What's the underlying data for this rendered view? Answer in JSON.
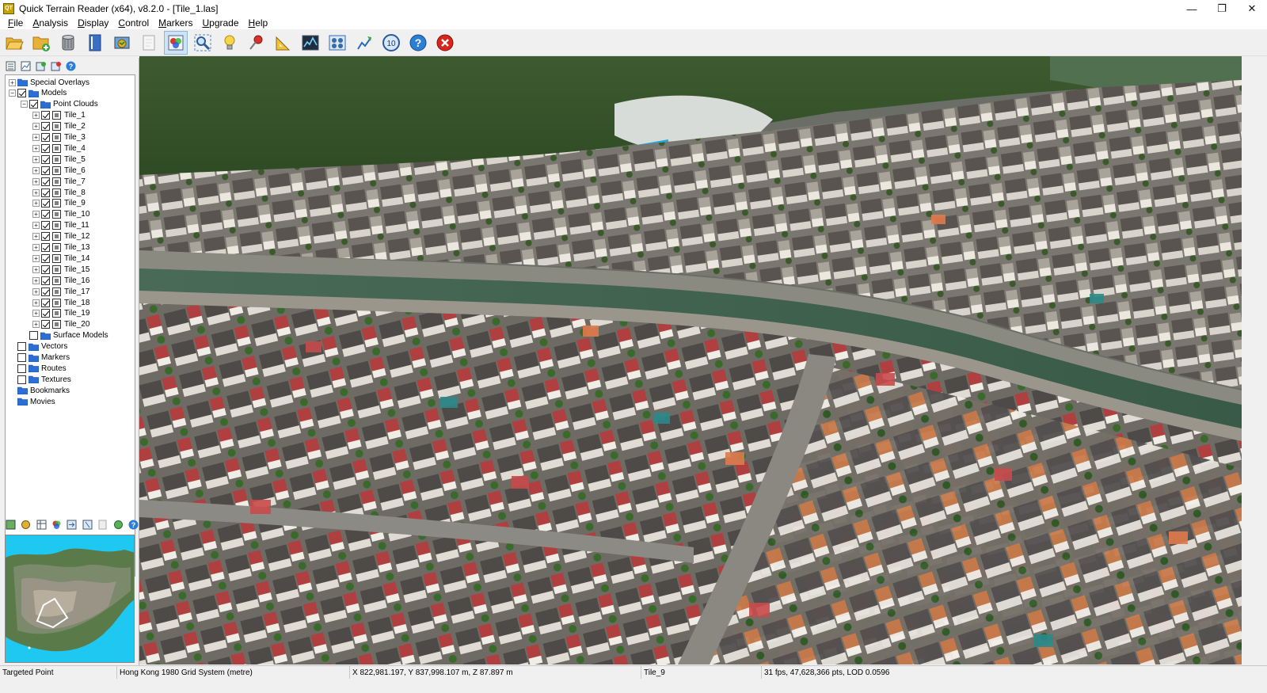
{
  "window": {
    "title": "Quick Terrain Reader (x64), v8.2.0 - [Tile_1.las]",
    "app_icon_text": "QT",
    "controls": [
      "minimize-icon",
      "restore-icon",
      "close-icon"
    ]
  },
  "menu": [
    "File",
    "Analysis",
    "Display",
    "Control",
    "Markers",
    "Upgrade",
    "Help"
  ],
  "toolbar": {
    "buttons": [
      {
        "name": "open-folder-icon"
      },
      {
        "name": "add-folder-icon"
      },
      {
        "name": "database-icon"
      },
      {
        "name": "book-icon"
      },
      {
        "name": "map-layers-icon"
      },
      {
        "name": "blank-page-icon"
      },
      {
        "name": "color-points-icon",
        "active": true
      },
      {
        "name": "zoom-extent-icon"
      },
      {
        "name": "lightbulb-icon"
      },
      {
        "name": "pushpin-icon"
      },
      {
        "name": "ruler-triangle-icon"
      },
      {
        "name": "profile-graph-icon"
      },
      {
        "name": "grid-view-icon"
      },
      {
        "name": "export-arrow-icon"
      },
      {
        "name": "clock-10-icon"
      },
      {
        "name": "help-icon"
      },
      {
        "name": "exit-icon"
      }
    ],
    "clock_label": "10",
    "help_label": "?"
  },
  "tree": {
    "special_overlays": "Special Overlays",
    "models": "Models",
    "point_clouds": "Point Clouds",
    "tiles": [
      "Tile_1",
      "Tile_2",
      "Tile_3",
      "Tile_4",
      "Tile_5",
      "Tile_6",
      "Tile_7",
      "Tile_8",
      "Tile_9",
      "Tile_10",
      "Tile_11",
      "Tile_12",
      "Tile_13",
      "Tile_14",
      "Tile_15",
      "Tile_16",
      "Tile_17",
      "Tile_18",
      "Tile_19",
      "Tile_20"
    ],
    "surface_models": "Surface Models",
    "vectors": "Vectors",
    "markers": "Markers",
    "routes": "Routes",
    "textures": "Textures",
    "bookmarks": "Bookmarks",
    "movies": "Movies"
  },
  "status": {
    "mode": "Targeted Point",
    "crs": "Hong Kong 1980 Grid System (metre)",
    "coords": "X 822,981.197, Y 837,998.107 m, Z 87.897 m",
    "tile": "Tile_9",
    "perf": "31 fps, 47,628,366 pts, LOD 0.0596"
  },
  "colors": {
    "folder": "#2b6fd6",
    "water": "#1ec8f0",
    "exit_red": "#d9261c",
    "help_blue": "#2a7fd4"
  }
}
